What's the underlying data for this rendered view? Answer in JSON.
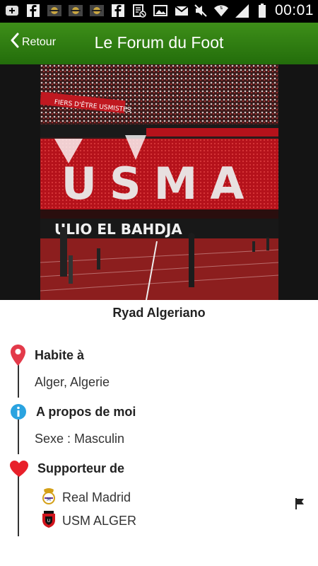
{
  "status_bar": {
    "time": "00:01",
    "left_icons": [
      "add-icon",
      "facebook-icon",
      "notification-icon",
      "notification-icon",
      "notification-icon",
      "facebook-icon",
      "image-block-icon",
      "gallery-icon",
      "mail-icon"
    ],
    "right_icons": [
      "mute-icon",
      "wifi-icon",
      "signal-icon",
      "battery-icon"
    ]
  },
  "app_bar": {
    "back_label": "Retour",
    "title": "Le Forum du Foot",
    "color": "#2f7d13"
  },
  "profile": {
    "name": "Ryad Algeriano",
    "sections": [
      {
        "label": "Habite à",
        "value": "Alger, Algerie",
        "icon": "location-pin-icon",
        "icon_color": "#e33a4a"
      },
      {
        "label": "A propos de moi",
        "value": "Sexe : Masculin",
        "icon": "info-icon",
        "icon_color": "#2aa3e0"
      },
      {
        "label": "Supporteur de",
        "icon": "heart-icon",
        "icon_color": "#e8202a",
        "teams": [
          {
            "name": "Real Madrid",
            "icon": "real-madrid-crest-icon"
          },
          {
            "name": "USM ALGER",
            "icon": "usm-alger-crest-icon"
          }
        ]
      }
    ]
  },
  "photo": {
    "banner_text": "USMA",
    "lower_banner_text": "ULIO EL BAHDJA",
    "top_banner_text": "FIERS D'ÊTRE USMISTES"
  }
}
